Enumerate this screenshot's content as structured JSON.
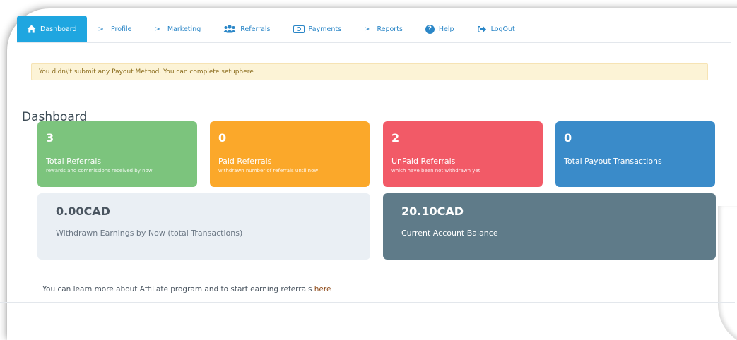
{
  "nav": {
    "items": [
      {
        "label": "Dashboard",
        "icon": "home-icon",
        "active": true
      },
      {
        "label": "Profile",
        "icon": "chevron-right-icon"
      },
      {
        "label": "Marketing",
        "icon": "chevron-right-icon"
      },
      {
        "label": "Referrals",
        "icon": "users-icon"
      },
      {
        "label": "Payments",
        "icon": "money-icon"
      },
      {
        "label": "Reports",
        "icon": "chevron-right-icon"
      },
      {
        "label": "Help",
        "icon": "question-icon"
      },
      {
        "label": "LogOut",
        "icon": "sign-out-icon"
      }
    ]
  },
  "alert": {
    "text": "You didn\\'t submit any Payout Method. You can complete setup ",
    "link": "here"
  },
  "page_title": "Dashboard",
  "stats": [
    {
      "value": "3",
      "label": "Total Referrals",
      "sub": "rewards and commissions received by now",
      "color": "#7cc47d"
    },
    {
      "value": "0",
      "label": "Paid Referrals",
      "sub": "withdrawn number of referrals until now",
      "color": "#fba82a"
    },
    {
      "value": "2",
      "label": "UnPaid Referrals",
      "sub": "which have been not withdrawn yet",
      "color": "#f25a67"
    },
    {
      "value": "0",
      "label": "Total Payout Transactions",
      "sub": "",
      "color": "#3a8bc9"
    }
  ],
  "earnings": {
    "withdrawn": {
      "amount": "0.00CAD",
      "label": "Withdrawn Earnings by Now (total Transactions)"
    },
    "balance": {
      "amount": "20.10CAD",
      "label": "Current Account Balance"
    }
  },
  "footer": {
    "text": "You can learn more about Affiliate program and to start earning referrals ",
    "link": "here"
  }
}
